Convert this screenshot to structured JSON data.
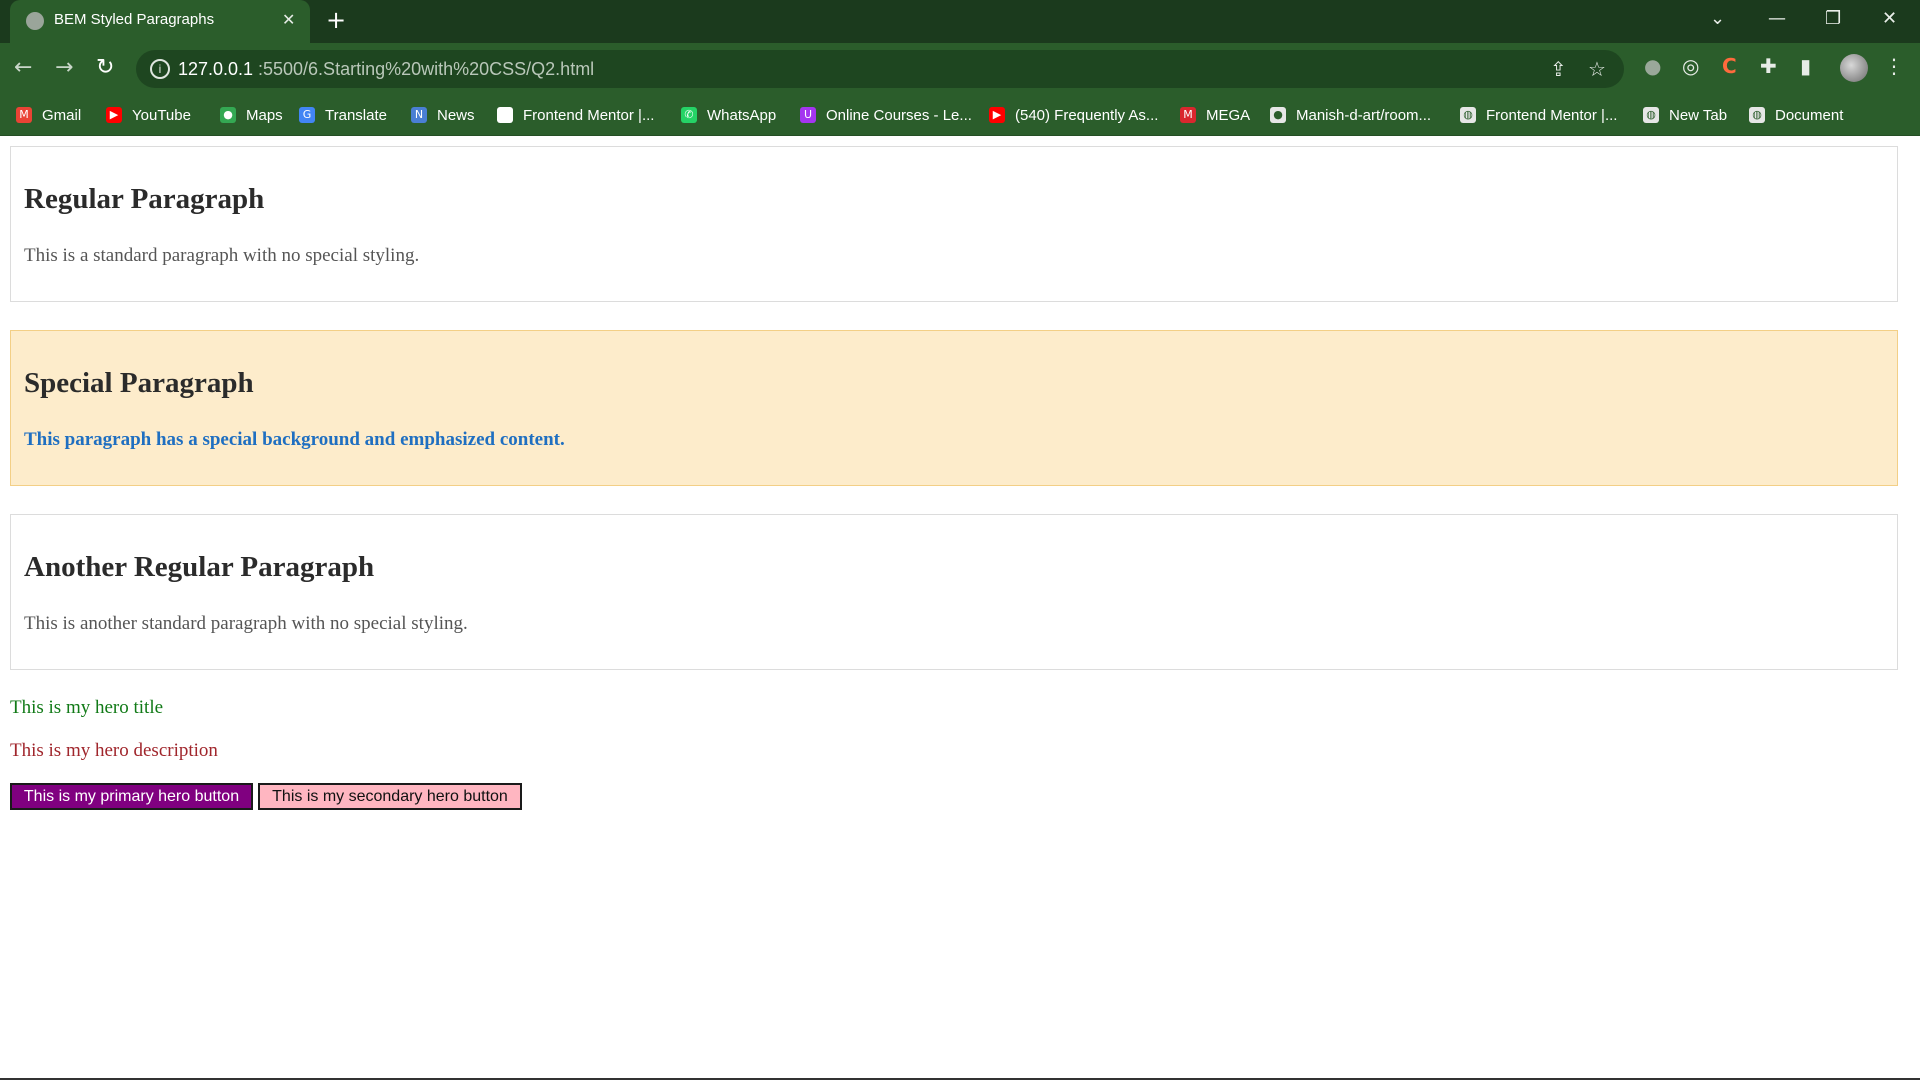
{
  "browser": {
    "tab_title": "BEM Styled Paragraphs",
    "tab_close": "✕",
    "new_tab": "+",
    "url_host": "127.0.0.1",
    "url_path": ":5500/6.Starting%20with%20CSS/Q2.html",
    "window_controls": {
      "dropdown": "⌄",
      "minimize": "—",
      "restore": "❐",
      "close": "✕"
    },
    "nav": {
      "back": "←",
      "forward": "→",
      "reload": "↻"
    },
    "bookmarks": [
      {
        "label": "Gmail",
        "icon": "gmail-icon",
        "color": "#ea4335",
        "glyph": "M"
      },
      {
        "label": "YouTube",
        "icon": "youtube-icon",
        "color": "#ff0000",
        "glyph": "▶"
      },
      {
        "label": "Maps",
        "icon": "maps-icon",
        "color": "#34a853",
        "glyph": "●"
      },
      {
        "label": "Translate",
        "icon": "translate-icon",
        "color": "#4285f4",
        "glyph": "G"
      },
      {
        "label": "News",
        "icon": "news-icon",
        "color": "#4a7fd4",
        "glyph": "N"
      },
      {
        "label": "Frontend Mentor |...",
        "icon": "frontend-mentor-icon",
        "color": "#ffffff",
        "glyph": ""
      },
      {
        "label": "WhatsApp",
        "icon": "whatsapp-icon",
        "color": "#25d366",
        "glyph": "✆"
      },
      {
        "label": "Online Courses - Le...",
        "icon": "udemy-icon",
        "color": "#a435f0",
        "glyph": "U"
      },
      {
        "label": "(540) Frequently As...",
        "icon": "youtube-icon",
        "color": "#ff0000",
        "glyph": "▶"
      },
      {
        "label": "MEGA",
        "icon": "mega-icon",
        "color": "#d9272e",
        "glyph": "M"
      },
      {
        "label": "Manish-d-art/room...",
        "icon": "github-icon",
        "color": "#e6e6e6",
        "glyph": "●"
      },
      {
        "label": "Frontend Mentor |...",
        "icon": "globe-icon",
        "color": "#e6e6e6",
        "glyph": "◍"
      },
      {
        "label": "New Tab",
        "icon": "globe-icon",
        "color": "#e6e6e6",
        "glyph": "◍"
      },
      {
        "label": "Document",
        "icon": "document-icon",
        "color": "#e6e6e6",
        "glyph": "◍"
      }
    ]
  },
  "page": {
    "cards": [
      {
        "heading": "Regular Paragraph",
        "text": "This is a standard paragraph with no special styling."
      },
      {
        "heading": "Special Paragraph",
        "text": "This paragraph has a special background and emphasized content."
      },
      {
        "heading": "Another Regular Paragraph",
        "text": "This is another standard paragraph with no special styling."
      }
    ],
    "hero": {
      "title": "This is my hero title",
      "description": "This is my hero description",
      "primary_button": "This is my primary hero button",
      "secondary_button": "This is my secondary hero button"
    }
  },
  "colors": {
    "chrome_dark": "#1b3a1d",
    "chrome": "#2b5d2b",
    "special_bg": "#fdeccb",
    "special_text": "#1f6fc1",
    "hero_title": "#117a17",
    "hero_description": "#a0262c",
    "primary_button": "#800080",
    "secondary_button": "#ffb6c1"
  }
}
